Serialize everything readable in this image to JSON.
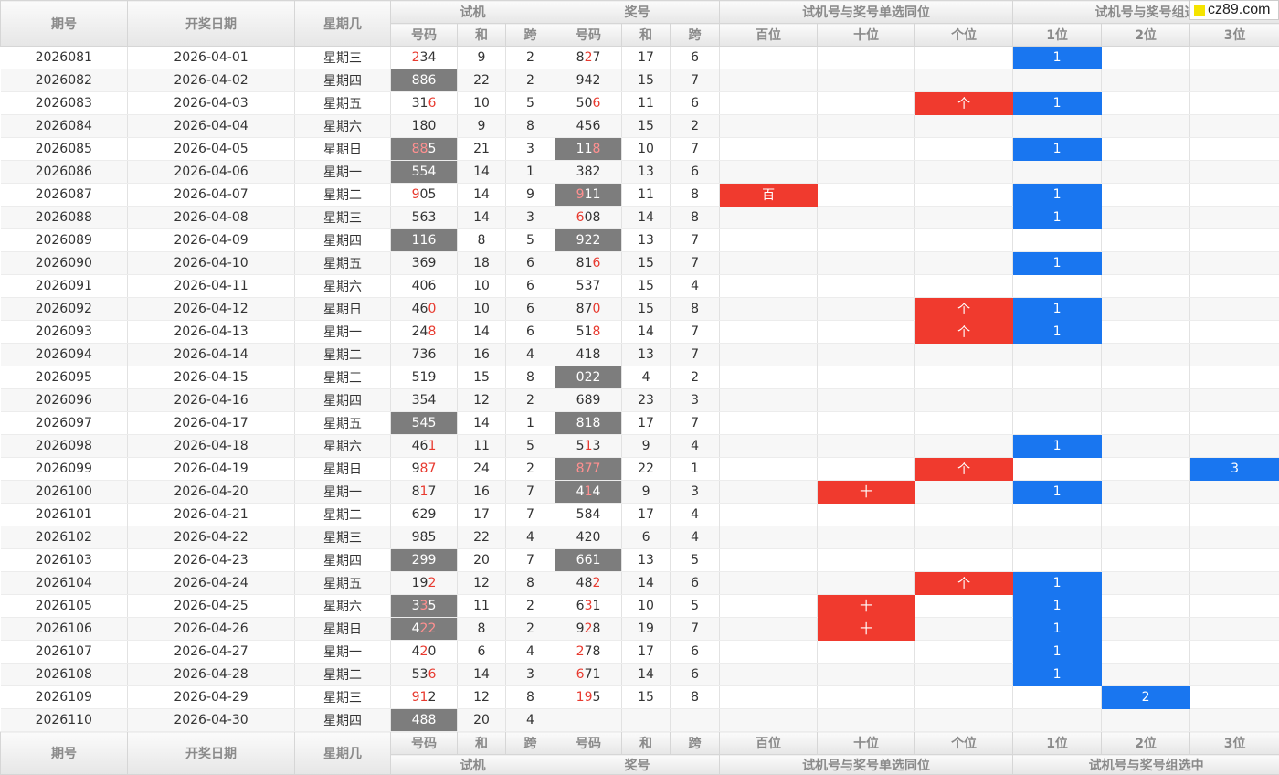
{
  "watermark": {
    "text": "cz89.com"
  },
  "headers": {
    "period": "期号",
    "date": "开奖日期",
    "weekday": "星期几",
    "trial": "试机",
    "prize": "奖号",
    "single_same": "试机号与奖号单选同位",
    "group_hit": "试机号与奖号组选中",
    "group_hit_top_visible": "试机号与奖号组选",
    "sub": {
      "code": "号码",
      "sum": "和",
      "span": "跨",
      "hundreds": "百位",
      "tens": "十位",
      "ones": "个位",
      "p1": "1位",
      "p2": "2位",
      "p3": "3位"
    }
  },
  "colors": {
    "red": "#f03a2e",
    "blue": "#1976f0",
    "grey_cell": "#7d7d7d",
    "red_digit": "#e83a2f"
  },
  "rows": [
    {
      "period": "2026081",
      "date": "2026-04-01",
      "weekday": "星期三",
      "trial": "234",
      "trial_red": [
        0
      ],
      "trial_hl": false,
      "tsum": "9",
      "tspan": "2",
      "prize": "827",
      "prize_red": [
        1
      ],
      "prize_hl": false,
      "psum": "17",
      "pspan": "6",
      "single": {},
      "group": {
        "1": "1"
      }
    },
    {
      "period": "2026082",
      "date": "2026-04-02",
      "weekday": "星期四",
      "trial": "886",
      "trial_red": [],
      "trial_hl": true,
      "tsum": "22",
      "tspan": "2",
      "prize": "942",
      "prize_red": [],
      "prize_hl": false,
      "psum": "15",
      "pspan": "7",
      "single": {},
      "group": {}
    },
    {
      "period": "2026083",
      "date": "2026-04-03",
      "weekday": "星期五",
      "trial": "316",
      "trial_red": [
        2
      ],
      "trial_hl": false,
      "tsum": "10",
      "tspan": "5",
      "prize": "506",
      "prize_red": [
        2
      ],
      "prize_hl": false,
      "psum": "11",
      "pspan": "6",
      "single": {
        "ones": "个"
      },
      "group": {
        "1": "1"
      }
    },
    {
      "period": "2026084",
      "date": "2026-04-04",
      "weekday": "星期六",
      "trial": "180",
      "trial_red": [],
      "trial_hl": false,
      "tsum": "9",
      "tspan": "8",
      "prize": "456",
      "prize_red": [],
      "prize_hl": false,
      "psum": "15",
      "pspan": "2",
      "single": {},
      "group": {}
    },
    {
      "period": "2026085",
      "date": "2026-04-05",
      "weekday": "星期日",
      "trial": "885",
      "trial_red": [
        0,
        1
      ],
      "trial_hl": true,
      "tsum": "21",
      "tspan": "3",
      "prize": "118",
      "prize_red": [
        2
      ],
      "prize_hl": true,
      "psum": "10",
      "pspan": "7",
      "single": {},
      "group": {
        "1": "1"
      }
    },
    {
      "period": "2026086",
      "date": "2026-04-06",
      "weekday": "星期一",
      "trial": "554",
      "trial_red": [],
      "trial_hl": true,
      "tsum": "14",
      "tspan": "1",
      "prize": "382",
      "prize_red": [],
      "prize_hl": false,
      "psum": "13",
      "pspan": "6",
      "single": {},
      "group": {}
    },
    {
      "period": "2026087",
      "date": "2026-04-07",
      "weekday": "星期二",
      "trial": "905",
      "trial_red": [
        0
      ],
      "trial_hl": false,
      "tsum": "14",
      "tspan": "9",
      "prize": "911",
      "prize_red": [
        0
      ],
      "prize_hl": true,
      "psum": "11",
      "pspan": "8",
      "single": {
        "hundreds": "百"
      },
      "group": {
        "1": "1"
      }
    },
    {
      "period": "2026088",
      "date": "2026-04-08",
      "weekday": "星期三",
      "trial": "563",
      "trial_red": [],
      "trial_hl": false,
      "tsum": "14",
      "tspan": "3",
      "prize": "608",
      "prize_red": [
        0
      ],
      "prize_hl": false,
      "psum": "14",
      "pspan": "8",
      "single": {},
      "group": {
        "1": "1"
      }
    },
    {
      "period": "2026089",
      "date": "2026-04-09",
      "weekday": "星期四",
      "trial": "116",
      "trial_red": [],
      "trial_hl": true,
      "tsum": "8",
      "tspan": "5",
      "prize": "922",
      "prize_red": [],
      "prize_hl": true,
      "psum": "13",
      "pspan": "7",
      "single": {},
      "group": {}
    },
    {
      "period": "2026090",
      "date": "2026-04-10",
      "weekday": "星期五",
      "trial": "369",
      "trial_red": [],
      "trial_hl": false,
      "tsum": "18",
      "tspan": "6",
      "prize": "816",
      "prize_red": [
        2
      ],
      "prize_hl": false,
      "psum": "15",
      "pspan": "7",
      "single": {},
      "group": {
        "1": "1"
      }
    },
    {
      "period": "2026091",
      "date": "2026-04-11",
      "weekday": "星期六",
      "trial": "406",
      "trial_red": [],
      "trial_hl": false,
      "tsum": "10",
      "tspan": "6",
      "prize": "537",
      "prize_red": [],
      "prize_hl": false,
      "psum": "15",
      "pspan": "4",
      "single": {},
      "group": {}
    },
    {
      "period": "2026092",
      "date": "2026-04-12",
      "weekday": "星期日",
      "trial": "460",
      "trial_red": [
        2
      ],
      "trial_hl": false,
      "tsum": "10",
      "tspan": "6",
      "prize": "870",
      "prize_red": [
        2
      ],
      "prize_hl": false,
      "psum": "15",
      "pspan": "8",
      "single": {
        "ones": "个"
      },
      "group": {
        "1": "1"
      }
    },
    {
      "period": "2026093",
      "date": "2026-04-13",
      "weekday": "星期一",
      "trial": "248",
      "trial_red": [
        2
      ],
      "trial_hl": false,
      "tsum": "14",
      "tspan": "6",
      "prize": "518",
      "prize_red": [
        2
      ],
      "prize_hl": false,
      "psum": "14",
      "pspan": "7",
      "single": {
        "ones": "个"
      },
      "group": {
        "1": "1"
      }
    },
    {
      "period": "2026094",
      "date": "2026-04-14",
      "weekday": "星期二",
      "trial": "736",
      "trial_red": [],
      "trial_hl": false,
      "tsum": "16",
      "tspan": "4",
      "prize": "418",
      "prize_red": [],
      "prize_hl": false,
      "psum": "13",
      "pspan": "7",
      "single": {},
      "group": {}
    },
    {
      "period": "2026095",
      "date": "2026-04-15",
      "weekday": "星期三",
      "trial": "519",
      "trial_red": [],
      "trial_hl": false,
      "tsum": "15",
      "tspan": "8",
      "prize": "022",
      "prize_red": [],
      "prize_hl": true,
      "psum": "4",
      "pspan": "2",
      "single": {},
      "group": {}
    },
    {
      "period": "2026096",
      "date": "2026-04-16",
      "weekday": "星期四",
      "trial": "354",
      "trial_red": [],
      "trial_hl": false,
      "tsum": "12",
      "tspan": "2",
      "prize": "689",
      "prize_red": [],
      "prize_hl": false,
      "psum": "23",
      "pspan": "3",
      "single": {},
      "group": {}
    },
    {
      "period": "2026097",
      "date": "2026-04-17",
      "weekday": "星期五",
      "trial": "545",
      "trial_red": [],
      "trial_hl": true,
      "tsum": "14",
      "tspan": "1",
      "prize": "818",
      "prize_red": [],
      "prize_hl": true,
      "psum": "17",
      "pspan": "7",
      "single": {},
      "group": {}
    },
    {
      "period": "2026098",
      "date": "2026-04-18",
      "weekday": "星期六",
      "trial": "461",
      "trial_red": [
        2
      ],
      "trial_hl": false,
      "tsum": "11",
      "tspan": "5",
      "prize": "513",
      "prize_red": [
        1
      ],
      "prize_hl": false,
      "psum": "9",
      "pspan": "4",
      "single": {},
      "group": {
        "1": "1"
      }
    },
    {
      "period": "2026099",
      "date": "2026-04-19",
      "weekday": "星期日",
      "trial": "987",
      "trial_red": [
        1,
        2
      ],
      "trial_hl": false,
      "tsum": "24",
      "tspan": "2",
      "prize": "877",
      "prize_red": [
        0,
        1,
        2
      ],
      "prize_hl": true,
      "psum": "22",
      "pspan": "1",
      "single": {
        "ones": "个"
      },
      "group": {
        "3": "3"
      }
    },
    {
      "period": "2026100",
      "date": "2026-04-20",
      "weekday": "星期一",
      "trial": "817",
      "trial_red": [
        1
      ],
      "trial_hl": false,
      "tsum": "16",
      "tspan": "7",
      "prize": "414",
      "prize_red": [
        1
      ],
      "prize_hl": true,
      "psum": "9",
      "pspan": "3",
      "single": {
        "tens": "十"
      },
      "group": {
        "1": "1"
      }
    },
    {
      "period": "2026101",
      "date": "2026-04-21",
      "weekday": "星期二",
      "trial": "629",
      "trial_red": [],
      "trial_hl": false,
      "tsum": "17",
      "tspan": "7",
      "prize": "584",
      "prize_red": [],
      "prize_hl": false,
      "psum": "17",
      "pspan": "4",
      "single": {},
      "group": {}
    },
    {
      "period": "2026102",
      "date": "2026-04-22",
      "weekday": "星期三",
      "trial": "985",
      "trial_red": [],
      "trial_hl": false,
      "tsum": "22",
      "tspan": "4",
      "prize": "420",
      "prize_red": [],
      "prize_hl": false,
      "psum": "6",
      "pspan": "4",
      "single": {},
      "group": {}
    },
    {
      "period": "2026103",
      "date": "2026-04-23",
      "weekday": "星期四",
      "trial": "299",
      "trial_red": [],
      "trial_hl": true,
      "tsum": "20",
      "tspan": "7",
      "prize": "661",
      "prize_red": [],
      "prize_hl": true,
      "psum": "13",
      "pspan": "5",
      "single": {},
      "group": {}
    },
    {
      "period": "2026104",
      "date": "2026-04-24",
      "weekday": "星期五",
      "trial": "192",
      "trial_red": [
        2
      ],
      "trial_hl": false,
      "tsum": "12",
      "tspan": "8",
      "prize": "482",
      "prize_red": [
        2
      ],
      "prize_hl": false,
      "psum": "14",
      "pspan": "6",
      "single": {
        "ones": "个"
      },
      "group": {
        "1": "1"
      }
    },
    {
      "period": "2026105",
      "date": "2026-04-25",
      "weekday": "星期六",
      "trial": "335",
      "trial_red": [
        1
      ],
      "trial_hl": true,
      "tsum": "11",
      "tspan": "2",
      "prize": "631",
      "prize_red": [
        1
      ],
      "prize_hl": false,
      "psum": "10",
      "pspan": "5",
      "single": {
        "tens": "十"
      },
      "group": {
        "1": "1"
      }
    },
    {
      "period": "2026106",
      "date": "2026-04-26",
      "weekday": "星期日",
      "trial": "422",
      "trial_red": [
        1,
        2
      ],
      "trial_hl": true,
      "tsum": "8",
      "tspan": "2",
      "prize": "928",
      "prize_red": [
        1
      ],
      "prize_hl": false,
      "psum": "19",
      "pspan": "7",
      "single": {
        "tens": "十"
      },
      "group": {
        "1": "1"
      }
    },
    {
      "period": "2026107",
      "date": "2026-04-27",
      "weekday": "星期一",
      "trial": "420",
      "trial_red": [
        1
      ],
      "trial_hl": false,
      "tsum": "6",
      "tspan": "4",
      "prize": "278",
      "prize_red": [
        0
      ],
      "prize_hl": false,
      "psum": "17",
      "pspan": "6",
      "single": {},
      "group": {
        "1": "1"
      }
    },
    {
      "period": "2026108",
      "date": "2026-04-28",
      "weekday": "星期二",
      "trial": "536",
      "trial_red": [
        2
      ],
      "trial_hl": false,
      "tsum": "14",
      "tspan": "3",
      "prize": "671",
      "prize_red": [
        0
      ],
      "prize_hl": false,
      "psum": "14",
      "pspan": "6",
      "single": {},
      "group": {
        "1": "1"
      }
    },
    {
      "period": "2026109",
      "date": "2026-04-29",
      "weekday": "星期三",
      "trial": "912",
      "trial_red": [
        0,
        1
      ],
      "trial_hl": false,
      "tsum": "12",
      "tspan": "8",
      "prize": "195",
      "prize_red": [
        0,
        1
      ],
      "prize_hl": false,
      "psum": "15",
      "pspan": "8",
      "single": {},
      "group": {
        "2": "2"
      }
    },
    {
      "period": "2026110",
      "date": "2026-04-30",
      "weekday": "星期四",
      "trial": "488",
      "trial_red": [],
      "trial_hl": true,
      "tsum": "20",
      "tspan": "4",
      "prize": "",
      "prize_red": [],
      "prize_hl": false,
      "psum": "",
      "pspan": "",
      "single": {},
      "group": {}
    }
  ]
}
